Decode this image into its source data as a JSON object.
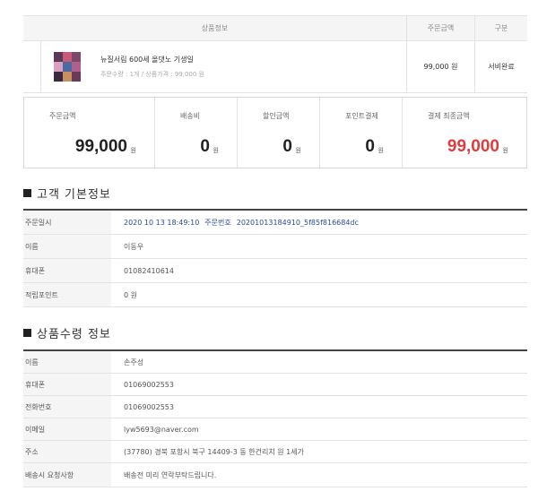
{
  "product_table": {
    "headers": {
      "product_info": "상품정보",
      "order_amount": "주문금액",
      "status": "구분"
    },
    "item": {
      "name": "뉴질서림 600세 올댓노 기생일",
      "option": "주문수량 : 1개 / 상품가격 : 99,000 원",
      "price": "99,000 원",
      "status": "서비완료"
    }
  },
  "summary": {
    "order_total": {
      "label": "주문금액",
      "value": "99,000",
      "unit": "원"
    },
    "shipping": {
      "label": "배송비",
      "value": "0",
      "unit": "원"
    },
    "discount": {
      "label": "할인금액",
      "value": "0",
      "unit": "원"
    },
    "points": {
      "label": "포인트결제",
      "value": "0",
      "unit": "원"
    },
    "final_total": {
      "label": "결제 최종금액",
      "value": "99,000",
      "unit": "원"
    },
    "accent_color": "#e03c3c"
  },
  "customer_section": {
    "title": "고객 기본정보",
    "rows": {
      "order_date": {
        "label": "주문일시",
        "date": "2020 10 13 18:49:10",
        "no_label": "주문번호",
        "order_no": "20201013184910_5f85f816684dc"
      },
      "name": {
        "label": "이름",
        "value": "이동우"
      },
      "phone": {
        "label": "휴대폰",
        "value": "01082410614"
      },
      "points": {
        "label": "적립포인트",
        "value": "0 원"
      }
    }
  },
  "recipient_section": {
    "title": "상품수령 정보",
    "rows": {
      "name": {
        "label": "이름",
        "value": "손주성"
      },
      "mobile": {
        "label": "휴대폰",
        "value": "01069002553"
      },
      "tel": {
        "label": "전화번호",
        "value": "01069002553"
      },
      "email": {
        "label": "이메일",
        "value": "lyw5693@naver.com"
      },
      "address": {
        "label": "주소",
        "value": "(37780) 경북 포항시 북구 14409-3 동 한건리치 원 1세가"
      },
      "memo": {
        "label": "배송시 요청사항",
        "value": "배송전 미리 연락부탁드립니다."
      }
    }
  }
}
